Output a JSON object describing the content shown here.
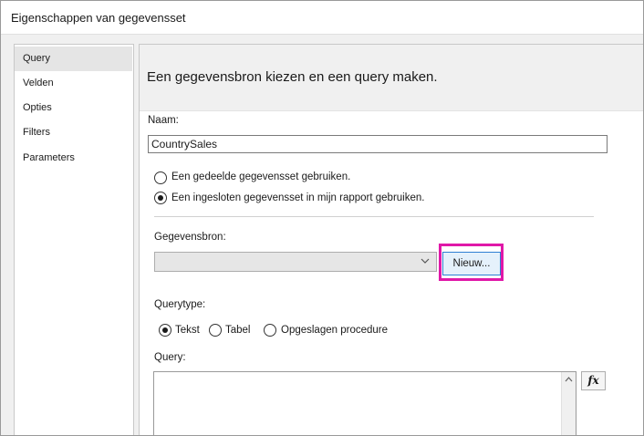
{
  "window": {
    "title": "Eigenschappen van gegevensset"
  },
  "nav": {
    "items": [
      {
        "label": "Query",
        "selected": true
      },
      {
        "label": "Velden"
      },
      {
        "label": "Opties"
      },
      {
        "label": "Filters"
      },
      {
        "label": "Parameters"
      }
    ]
  },
  "content": {
    "heading": "Een gegevensbron kiezen en een query maken.",
    "name_label": "Naam:",
    "name_value": "CountrySales",
    "radio_shared": "Een gedeelde gegevensset gebruiken.",
    "radio_embedded": "Een ingesloten gegevensset in mijn rapport gebruiken.",
    "datasource_label": "Gegevensbron:",
    "datasource_value": "",
    "new_button": "Nieuw...",
    "querytype_label": "Querytype:",
    "querytype_options": [
      "Tekst",
      "Tabel",
      "Opgeslagen procedure"
    ],
    "query_label": "Query:",
    "query_value": "",
    "fx_button": "fx"
  },
  "colors": {
    "highlight": "#e018a8",
    "button_border": "#2e7fd3",
    "button_bg": "#e5f1fb"
  }
}
